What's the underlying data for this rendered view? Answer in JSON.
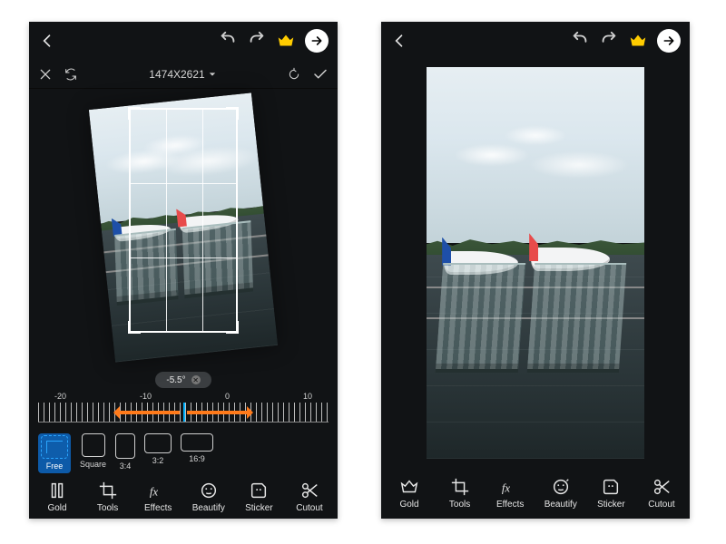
{
  "colors": {
    "accent_blue": "#00b2ff",
    "active_blue": "#0d5aa8",
    "crown_yellow": "#ffcc00",
    "arrow_orange": "#ff7a1a"
  },
  "left": {
    "dimensions": "1474X2621",
    "rotation_angle": "-5.5°",
    "ruler_ticks": {
      "min": "-20",
      "mid_neg": "-10",
      "zero": "0",
      "mid_pos": "10"
    },
    "aspects": {
      "free": "Free",
      "square": "Square",
      "r34": "3:4",
      "r32": "3:2",
      "r169": "16:9"
    }
  },
  "nav": {
    "gold": "Gold",
    "tools": "Tools",
    "effects": "Effects",
    "beautify": "Beautify",
    "sticker": "Sticker",
    "cutout": "Cutout"
  }
}
